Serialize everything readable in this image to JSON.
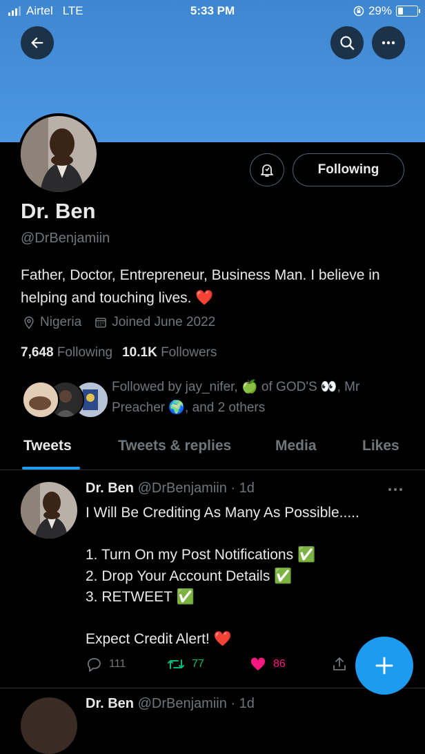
{
  "status_bar": {
    "carrier": "Airtel",
    "network": "LTE",
    "time": "5:33 PM",
    "battery": "29%",
    "battery_level": 0.29
  },
  "profile": {
    "name": "Dr. Ben",
    "handle": "@DrBenjamiin",
    "bio": "Father, Doctor, Entrepreneur, Business Man. I believe in helping and touching lives.",
    "bio_emoji": "❤️",
    "location": "Nigeria",
    "joined": "Joined June 2022",
    "following_count": "7,648",
    "following_label": "Following",
    "followers_count": "10.1K",
    "followers_label": "Followers",
    "follow_button": "Following",
    "followed_by": "Followed by jay_nifer, 🍏 of GOD'S 👀, Mr Preacher 🌍, and 2 others"
  },
  "tabs": [
    {
      "label": "Tweets",
      "active": true
    },
    {
      "label": "Tweets & replies",
      "active": false
    },
    {
      "label": "Media",
      "active": false
    },
    {
      "label": "Likes",
      "active": false
    }
  ],
  "tweet": {
    "author": "Dr. Ben",
    "handle": "@DrBenjamiin",
    "time": "· 1d",
    "text": "I Will Be Crediting As Many As Possible.....\n\n1. Turn On my Post Notifications  ✅\n2. Drop Your Account Details  ✅\n3. RETWEET  ✅\n\nExpect Credit Alert! ❤️",
    "replies": "111",
    "retweets": "77",
    "likes": "86"
  },
  "next_tweet": {
    "author": "Dr. Ben",
    "handle": "@DrBenjamiin",
    "time": "· 1d"
  },
  "colors": {
    "accent": "#1d9bf0",
    "like": "#f91880",
    "retweet": "#00ba7c",
    "banner": "#4b97e2"
  },
  "icons": [
    "back-arrow-icon",
    "search-icon",
    "more-icon",
    "bell-icon",
    "location-icon",
    "calendar-icon",
    "reply-icon",
    "retweet-icon",
    "heart-icon",
    "share-icon",
    "compose-plus-icon"
  ]
}
